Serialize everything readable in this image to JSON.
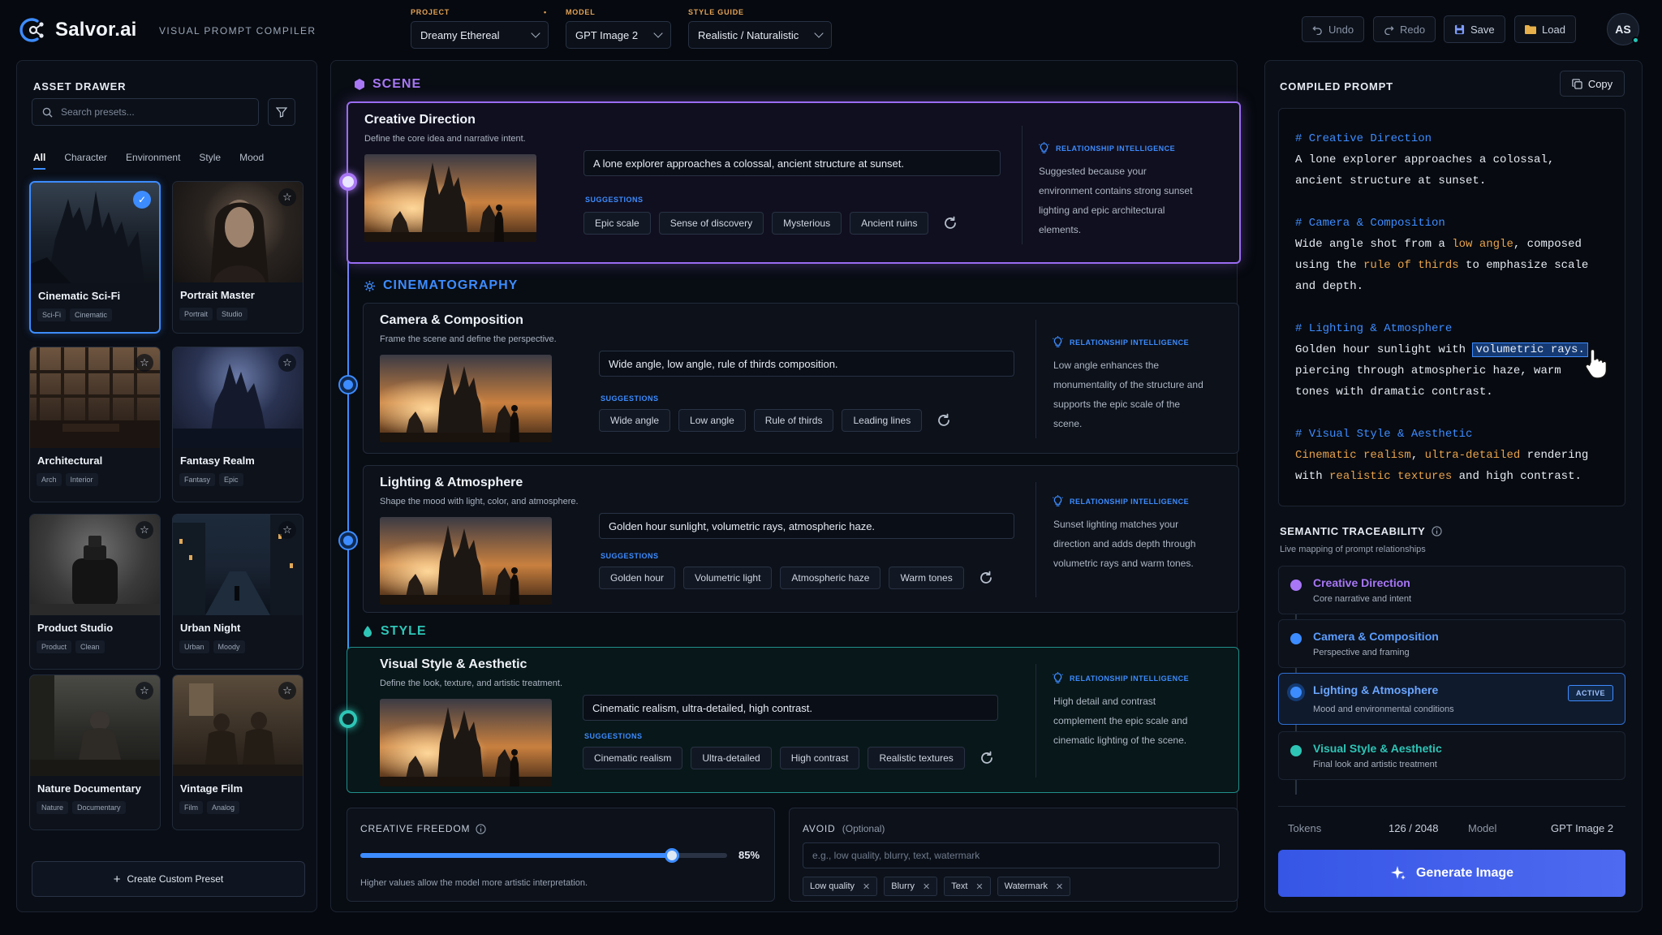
{
  "app": {
    "name": "Salvor.ai",
    "subtitle": "VISUAL PROMPT COMPILER",
    "selectors": [
      {
        "label": "PROJECT",
        "value": "Dreamy Ethereal",
        "marker": "•"
      },
      {
        "label": "MODEL",
        "value": "GPT Image 2"
      },
      {
        "label": "STYLE GUIDE",
        "value": "Realistic / Naturalistic"
      }
    ],
    "actions": {
      "undo": "Undo",
      "redo": "Redo",
      "save": "Save",
      "load": "Load"
    },
    "user_initials": "AS"
  },
  "asset_drawer": {
    "title": "ASSET DRAWER",
    "search_placeholder": "Search presets...",
    "filters": [
      "All",
      "Character",
      "Environment",
      "Style",
      "Mood"
    ],
    "active_filter": "All",
    "presets": [
      {
        "name": "Cinematic Sci-Fi",
        "tags": [
          "Sci-Fi",
          "Cinematic"
        ],
        "selected": true
      },
      {
        "name": "Portrait Master",
        "tags": [
          "Portrait",
          "Studio"
        ]
      },
      {
        "name": "Architectural",
        "tags": [
          "Arch",
          "Interior"
        ]
      },
      {
        "name": "Fantasy Realm",
        "tags": [
          "Fantasy",
          "Epic"
        ]
      },
      {
        "name": "Product Studio",
        "tags": [
          "Product",
          "Clean"
        ]
      },
      {
        "name": "Urban Night",
        "tags": [
          "Urban",
          "Moody"
        ]
      },
      {
        "name": "Nature Documentary",
        "tags": [
          "Nature",
          "Documentary"
        ]
      },
      {
        "name": "Vintage Film",
        "tags": [
          "Film",
          "Analog"
        ]
      }
    ],
    "create_label": "Create Custom Preset"
  },
  "sections": {
    "scene": "SCENE",
    "cinematography": "CINEMATOGRAPHY",
    "style": "STYLE"
  },
  "blocks": {
    "creative": {
      "title": "Creative Direction",
      "desc": "Define the core idea and narrative intent.",
      "input": "A lone explorer approaches a colossal, ancient structure at sunset.",
      "suggestions_label": "SUGGESTIONS",
      "suggestions": [
        "Epic scale",
        "Sense of discovery",
        "Mysterious",
        "Ancient ruins"
      ],
      "ri_label": "RELATIONSHIP INTELLIGENCE",
      "ri_text": "Suggested because your environment contains strong sunset lighting and epic architectural elements."
    },
    "camera": {
      "title": "Camera & Composition",
      "desc": "Frame the scene and define the perspective.",
      "input": "Wide angle, low angle, rule of thirds composition.",
      "suggestions_label": "SUGGESTIONS",
      "suggestions": [
        "Wide angle",
        "Low angle",
        "Rule of thirds",
        "Leading lines"
      ],
      "ri_label": "RELATIONSHIP INTELLIGENCE",
      "ri_text": "Low angle enhances the monumentality of the structure and supports the epic scale of the scene."
    },
    "lighting": {
      "title": "Lighting & Atmosphere",
      "desc": "Shape the mood with light, color, and atmosphere.",
      "input": "Golden hour sunlight, volumetric rays, atmospheric haze.",
      "suggestions_label": "SUGGESTIONS",
      "suggestions": [
        "Golden hour",
        "Volumetric light",
        "Atmospheric haze",
        "Warm tones"
      ],
      "ri_label": "RELATIONSHIP INTELLIGENCE",
      "ri_text": "Sunset lighting matches your direction and adds depth through volumetric rays and warm tones."
    },
    "visual": {
      "title": "Visual Style & Aesthetic",
      "desc": "Define the look, texture, and artistic treatment.",
      "input": "Cinematic realism, ultra-detailed, high contrast.",
      "suggestions_label": "SUGGESTIONS",
      "suggestions": [
        "Cinematic realism",
        "Ultra-detailed",
        "High contrast",
        "Realistic textures"
      ],
      "ri_label": "RELATIONSHIP INTELLIGENCE",
      "ri_text": "High detail and contrast complement the epic scale and cinematic lighting of the scene."
    }
  },
  "creative_freedom": {
    "label": "CREATIVE FREEDOM",
    "value": 0.85,
    "value_text": "85%",
    "hint": "Higher values allow the model more artistic interpretation."
  },
  "avoid": {
    "label": "AVOID",
    "optional": "(Optional)",
    "placeholder": "e.g., low quality, blurry, text, watermark",
    "tags": [
      "Low quality",
      "Blurry",
      "Text",
      "Watermark"
    ]
  },
  "compiled": {
    "title": "COMPILED PROMPT",
    "copy": "Copy",
    "s1_h": "# Creative Direction",
    "s1_l1": "A lone explorer approaches a colossal,",
    "s1_l2": "ancient structure at sunset.",
    "s2_h": "# Camera & Composition",
    "s2_a": "Wide angle shot from a ",
    "s2_b": "low angle",
    "s2_c": ", composed",
    "s2_d": "using the ",
    "s2_e": "rule of thirds",
    "s2_f": " to emphasize scale",
    "s2_g": "and depth.",
    "s3_h": "# Lighting & Atmosphere",
    "s3_a": "Golden hour sunlight with ",
    "s3_b": "volumetric rays.",
    "s3_c": "piercing through atmospheric haze, warm",
    "s3_d": "tones with dramatic contrast.",
    "s4_h": "# Visual Style & Aesthetic",
    "s4_a": "Cinematic realism",
    "s4_b": ", ",
    "s4_c": "ultra-detailed",
    "s4_d": " rendering",
    "s4_e": "with ",
    "s4_f": "realistic textures",
    "s4_g": " and high contrast."
  },
  "traceability": {
    "title": "SEMANTIC TRACEABILITY",
    "subtitle": "Live mapping of prompt relationships",
    "items": [
      {
        "name": "Creative Direction",
        "desc": "Core narrative and intent",
        "color": "#a877f5"
      },
      {
        "name": "Camera & Composition",
        "desc": "Perspective and framing",
        "color": "#3d8cff"
      },
      {
        "name": "Lighting & Atmosphere",
        "desc": "Mood and environmental conditions",
        "color": "#3d8cff",
        "badge": "ACTIVE"
      },
      {
        "name": "Visual Style & Aesthetic",
        "desc": "Final look and artistic treatment",
        "color": "#2ec5b6"
      }
    ]
  },
  "footer": {
    "tokens_label": "Tokens",
    "tokens_value": "126 / 2048",
    "model_label": "Model",
    "model_value": "GPT Image 2",
    "generate": "Generate Image"
  },
  "colors": {
    "scene": "#a877f5",
    "cinematography": "#3d8cff",
    "style": "#2ec5b6",
    "accent": "#3d8cff",
    "highlight": "#e8a24b"
  }
}
